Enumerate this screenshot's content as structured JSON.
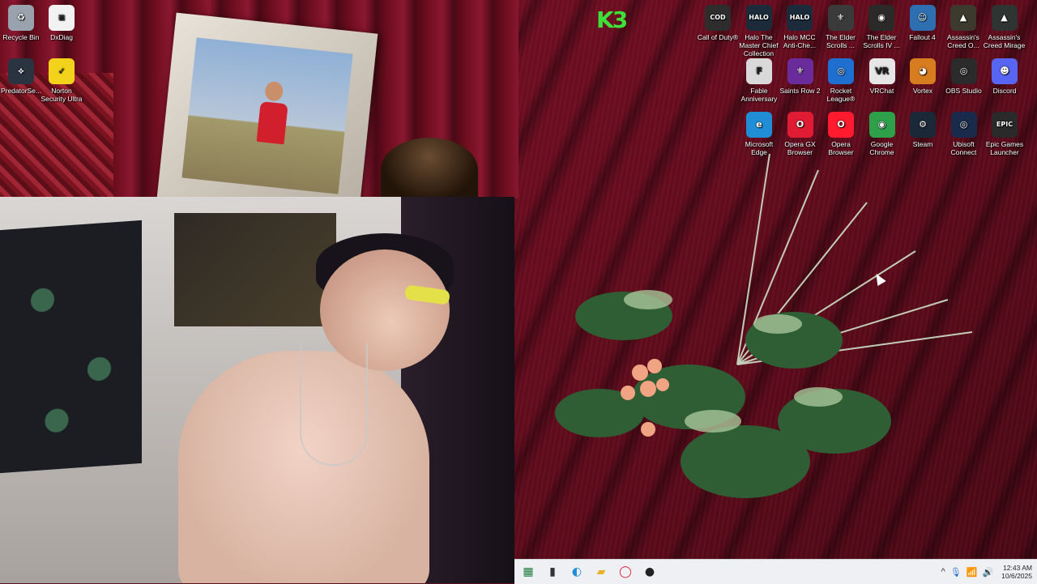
{
  "desktop": {
    "icons_left": [
      {
        "label": "Recycle Bin",
        "icon": "recycle-bin-icon",
        "color": "#9aa3ad",
        "glyph": "♻"
      },
      {
        "label": "DxDiag",
        "icon": "document-icon",
        "color": "#f2f2f2",
        "glyph": "≡"
      },
      {
        "label": "PredatorSe...",
        "icon": "predator-sense-icon",
        "color": "#2a3340",
        "glyph": "⟡"
      },
      {
        "label": "Norton Security Ultra",
        "icon": "norton-icon",
        "color": "#f2d21a",
        "glyph": "✓"
      }
    ],
    "icons_right_row1": [
      {
        "label": "Call of Duty®",
        "icon": "call-of-duty-icon",
        "color": "#2d2d2d",
        "glyph": "COD"
      },
      {
        "label": "Halo The Master Chief Collection",
        "icon": "halo-mcc-icon",
        "color": "#1c2b3a",
        "glyph": "HALO"
      },
      {
        "label": "Halo MCC Anti-Che...",
        "icon": "halo-anticheat-icon",
        "color": "#1c2b3a",
        "glyph": "HALO"
      },
      {
        "label": "The Elder Scrolls ...",
        "icon": "elder-scrolls-skyrim-icon",
        "color": "#3a3a3a",
        "glyph": "⚜"
      },
      {
        "label": "The Elder Scrolls IV ...",
        "icon": "elder-scrolls-oblivion-icon",
        "color": "#2c2a29",
        "glyph": "◉"
      },
      {
        "label": "Fallout 4",
        "icon": "fallout-4-icon",
        "color": "#2d6fb0",
        "glyph": "☺"
      },
      {
        "label": "Assassin's Creed O...",
        "icon": "assassins-creed-origins-icon",
        "color": "#3b3a2c",
        "glyph": "▲"
      },
      {
        "label": "Assassin's Creed Mirage",
        "icon": "assassins-creed-mirage-icon",
        "color": "#2d3432",
        "glyph": "▲"
      }
    ],
    "icons_right_row2": [
      {
        "label": "Fable Anniversary",
        "icon": "fable-icon",
        "color": "#d9d9d9",
        "glyph": "F"
      },
      {
        "label": "Saints Row 2",
        "icon": "saints-row-icon",
        "color": "#6a2c9a",
        "glyph": "⚜"
      },
      {
        "label": "Rocket League®",
        "icon": "rocket-league-icon",
        "color": "#1e6fd0",
        "glyph": "◎"
      },
      {
        "label": "VRChat",
        "icon": "vrchat-icon",
        "color": "#e6e6e6",
        "glyph": "VR"
      },
      {
        "label": "Vortex",
        "icon": "vortex-icon",
        "color": "#d87d1f",
        "glyph": "◕"
      },
      {
        "label": "OBS Studio",
        "icon": "obs-studio-icon",
        "color": "#2b2b2b",
        "glyph": "◎"
      },
      {
        "label": "Discord",
        "icon": "discord-icon",
        "color": "#5865f2",
        "glyph": "☻"
      }
    ],
    "icons_right_row3": [
      {
        "label": "Microsoft Edge",
        "icon": "edge-icon",
        "color": "#1f8ed6",
        "glyph": "e"
      },
      {
        "label": "Opera GX Browser",
        "icon": "opera-gx-icon",
        "color": "#e01b34",
        "glyph": "O"
      },
      {
        "label": "Opera Browser",
        "icon": "opera-icon",
        "color": "#ff1b2d",
        "glyph": "O"
      },
      {
        "label": "Google Chrome",
        "icon": "chrome-icon",
        "color": "#2ea04a",
        "glyph": "◉"
      },
      {
        "label": "Steam",
        "icon": "steam-icon",
        "color": "#1b2838",
        "glyph": "⚙"
      },
      {
        "label": "Ubisoft Connect",
        "icon": "ubisoft-connect-icon",
        "color": "#1a2a4a",
        "glyph": "◎"
      },
      {
        "label": "Epic Games Launcher",
        "icon": "epic-games-icon",
        "color": "#2a2a2a",
        "glyph": "EPIC"
      }
    ],
    "overlay_logo": "K3"
  },
  "taskbar": {
    "apps": [
      {
        "name": "taskbar-excel",
        "icon": "excel-icon",
        "glyph": "▦",
        "color": "#1f7a3f"
      },
      {
        "name": "taskbar-terminal",
        "icon": "terminal-icon",
        "glyph": "▮",
        "color": "#333333"
      },
      {
        "name": "taskbar-edge",
        "icon": "edge-icon",
        "glyph": "◐",
        "color": "#1f8ed6"
      },
      {
        "name": "taskbar-file-explorer",
        "icon": "folder-icon",
        "glyph": "▰",
        "color": "#e8b32a"
      },
      {
        "name": "taskbar-opera",
        "icon": "opera-icon",
        "glyph": "◯",
        "color": "#e01b34"
      },
      {
        "name": "taskbar-obs",
        "icon": "obs-icon",
        "glyph": "●",
        "color": "#222222"
      }
    ],
    "tray": {
      "chevron": "^",
      "time": "12:43 AM",
      "date": "10/6/2025"
    }
  }
}
